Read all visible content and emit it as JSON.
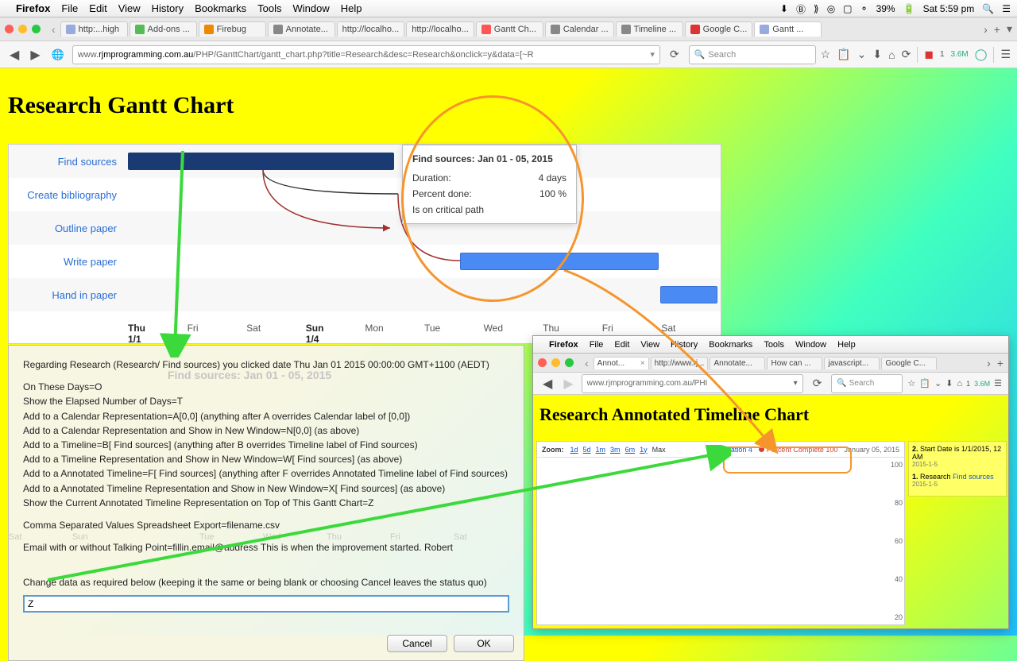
{
  "mac": {
    "app": "Firefox",
    "menus": [
      "File",
      "Edit",
      "View",
      "History",
      "Bookmarks",
      "Tools",
      "Window",
      "Help"
    ],
    "battery": "39%",
    "clock": "Sat 5:59 pm"
  },
  "tabs": {
    "items": [
      {
        "label": "http:...high"
      },
      {
        "label": "Add-ons ..."
      },
      {
        "label": "Firebug"
      },
      {
        "label": "Annotate..."
      },
      {
        "label": "http://localho..."
      },
      {
        "label": "http://localho..."
      },
      {
        "label": "Gantt Ch..."
      },
      {
        "label": "Calendar ..."
      },
      {
        "label": "Timeline ..."
      },
      {
        "label": "Google C..."
      },
      {
        "label": "Gantt ..."
      }
    ],
    "activeIndex": 10
  },
  "url": {
    "prefix": "www.",
    "host": "rjmprogramming.com.au",
    "path": "/PHP/GanttChart/gantt_chart.php?title=Research&desc=Research&onclick=y&data=[~R"
  },
  "search": {
    "placeholder": "Search"
  },
  "page": {
    "title": "Research Gantt Chart",
    "tasks": [
      {
        "name": "Find sources"
      },
      {
        "name": "Create bibliography"
      },
      {
        "name": "Outline paper"
      },
      {
        "name": "Write paper"
      },
      {
        "name": "Hand in paper"
      }
    ],
    "axis": [
      "Thu\n1/1",
      "Fri",
      "Sat",
      "Sun\n1/4",
      "Mon",
      "Tue",
      "Wed",
      "Thu",
      "Fri",
      "Sat"
    ],
    "axisBold": [
      0,
      3
    ]
  },
  "tooltip": {
    "title": "Find sources: Jan 01 - 05, 2015",
    "rows": [
      {
        "k": "Duration:",
        "v": "4 days"
      },
      {
        "k": "Percent done:",
        "v": "100 %"
      }
    ],
    "footer": "Is on critical path"
  },
  "prompt": {
    "faded": "Find sources: Jan 01 - 05, 2015",
    "lines": [
      "Regarding Research (Research/ Find sources) you clicked date Thu Jan 01 2015 00:00:00 GMT+1100 (AEDT)",
      "",
      "On These Days=O",
      "Show the Elapsed Number of Days=T",
      "Add to a Calendar Representation=A[0,0] (anything after A overrides Calendar label of [0,0])",
      "Add to a Calendar Representation and Show in New Window=N[0,0] (as above)",
      "Add to a Timeline=B[ Find sources] (anything after B overrides Timeline label of  Find sources)",
      "Add to a Timeline Representation and Show in New Window=W[ Find sources] (as above)",
      "Add to a Annotated Timeline=F[ Find sources] (anything after F overrides Annotated Timeline label of  Find sources)",
      "Add to a Annotated Timeline Representation and Show in New Window=X[ Find sources] (as above)",
      "Show the Current Annotated Timeline Representation on Top of This Gantt Chart=Z",
      "",
      "Comma Separated Values Spreadsheet Export=filename.csv",
      "",
      "Email with or without Talking Point=fillin.email@address This is when the improvement started.  Robert",
      "",
      "",
      "Change data as required below (keeping it the same or being blank or choosing Cancel leaves the status quo)"
    ],
    "ghost": [
      "Sat",
      "Sun",
      "",
      "Tue",
      "Wed",
      "Thu",
      "Fri",
      "Sat"
    ],
    "value": "Z",
    "cancel": "Cancel",
    "ok": "OK"
  },
  "inset": {
    "mac": {
      "app": "Firefox",
      "menus": [
        "File",
        "Edit",
        "View",
        "History",
        "Bookmarks",
        "Tools",
        "Window",
        "Help"
      ]
    },
    "tabs": [
      {
        "label": "Annot..."
      },
      {
        "label": "http://www.rj..."
      },
      {
        "label": "Annotate..."
      },
      {
        "label": "How can ..."
      },
      {
        "label": "javascript..."
      },
      {
        "label": "Google C..."
      }
    ],
    "url": "www.rjmprogramming.com.au/PHI",
    "search": "Search",
    "title": "Research Annotated Timeline Chart",
    "zoom": {
      "label": "Zoom:",
      "levels": [
        "1d",
        "5d",
        "1m",
        "3m",
        "6m",
        "1y"
      ],
      "max": "Max"
    },
    "legend": [
      {
        "name": "Duration 4",
        "color": "#1155cc"
      },
      {
        "name": "Percent Complete 100",
        "color": "#d9402a"
      }
    ],
    "date": "January 05, 2015",
    "yaxis": [
      "100",
      "80",
      "60",
      "40",
      "20"
    ],
    "notes": [
      {
        "n": "2.",
        "title": "Start Date is 1/1/2015, 12 AM",
        "sub": "2015-1-5"
      },
      {
        "n": "1.",
        "title": "Research",
        "extra": "Find sources",
        "sub": "2015-1-5"
      }
    ],
    "toolbadge": "3.6M"
  },
  "toolbadge": "3.6M"
}
